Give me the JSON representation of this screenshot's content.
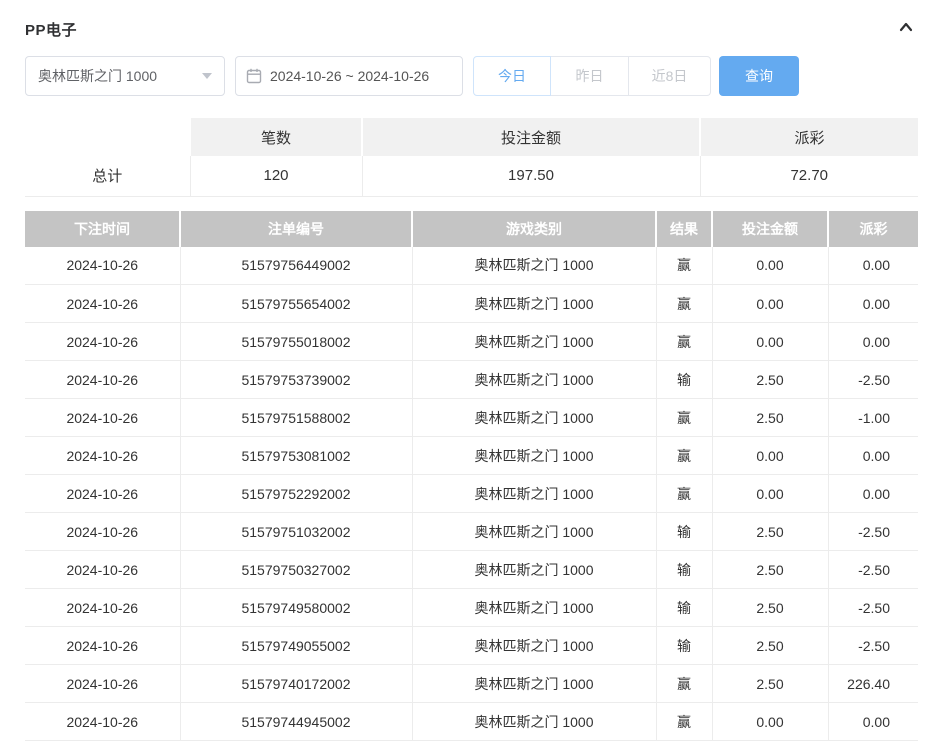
{
  "header": {
    "title": "PP电子"
  },
  "filters": {
    "game_select": {
      "value": "奥林匹斯之门 1000"
    },
    "date_range": {
      "value": "2024-10-26 ~ 2024-10-26"
    },
    "quick_buttons": [
      {
        "label": "今日",
        "active": true
      },
      {
        "label": "昨日",
        "active": false
      },
      {
        "label": "近8日",
        "active": false
      }
    ],
    "search_label": "查询"
  },
  "summary": {
    "headers": [
      "",
      "笔数",
      "投注金额",
      "派彩"
    ],
    "row_label": "总计",
    "count": "120",
    "bet_amount": "197.50",
    "payout": "72.70"
  },
  "table": {
    "headers": [
      "下注时间",
      "注单编号",
      "游戏类别",
      "结果",
      "投注金额",
      "派彩"
    ],
    "rows": [
      {
        "time": "2024-10-26",
        "id": "51579756449002",
        "game": "奥林匹斯之门 1000",
        "result": "赢",
        "bet": "0.00",
        "payout": "0.00"
      },
      {
        "time": "2024-10-26",
        "id": "51579755654002",
        "game": "奥林匹斯之门 1000",
        "result": "赢",
        "bet": "0.00",
        "payout": "0.00"
      },
      {
        "time": "2024-10-26",
        "id": "51579755018002",
        "game": "奥林匹斯之门 1000",
        "result": "赢",
        "bet": "0.00",
        "payout": "0.00"
      },
      {
        "time": "2024-10-26",
        "id": "51579753739002",
        "game": "奥林匹斯之门 1000",
        "result": "输",
        "bet": "2.50",
        "payout": "-2.50"
      },
      {
        "time": "2024-10-26",
        "id": "51579751588002",
        "game": "奥林匹斯之门 1000",
        "result": "赢",
        "bet": "2.50",
        "payout": "-1.00"
      },
      {
        "time": "2024-10-26",
        "id": "51579753081002",
        "game": "奥林匹斯之门 1000",
        "result": "赢",
        "bet": "0.00",
        "payout": "0.00"
      },
      {
        "time": "2024-10-26",
        "id": "51579752292002",
        "game": "奥林匹斯之门 1000",
        "result": "赢",
        "bet": "0.00",
        "payout": "0.00"
      },
      {
        "time": "2024-10-26",
        "id": "51579751032002",
        "game": "奥林匹斯之门 1000",
        "result": "输",
        "bet": "2.50",
        "payout": "-2.50"
      },
      {
        "time": "2024-10-26",
        "id": "51579750327002",
        "game": "奥林匹斯之门 1000",
        "result": "输",
        "bet": "2.50",
        "payout": "-2.50"
      },
      {
        "time": "2024-10-26",
        "id": "51579749580002",
        "game": "奥林匹斯之门 1000",
        "result": "输",
        "bet": "2.50",
        "payout": "-2.50"
      },
      {
        "time": "2024-10-26",
        "id": "51579749055002",
        "game": "奥林匹斯之门 1000",
        "result": "输",
        "bet": "2.50",
        "payout": "-2.50"
      },
      {
        "time": "2024-10-26",
        "id": "51579740172002",
        "game": "奥林匹斯之门 1000",
        "result": "赢",
        "bet": "2.50",
        "payout": "226.40"
      },
      {
        "time": "2024-10-26",
        "id": "51579744945002",
        "game": "奥林匹斯之门 1000",
        "result": "赢",
        "bet": "0.00",
        "payout": "0.00"
      }
    ]
  },
  "colors": {
    "accent_blue": "#64aaf0",
    "negative_red": "#ef6270",
    "table_header_bg": "#c4c4c4",
    "summary_header_bg": "#f1f1f1"
  }
}
